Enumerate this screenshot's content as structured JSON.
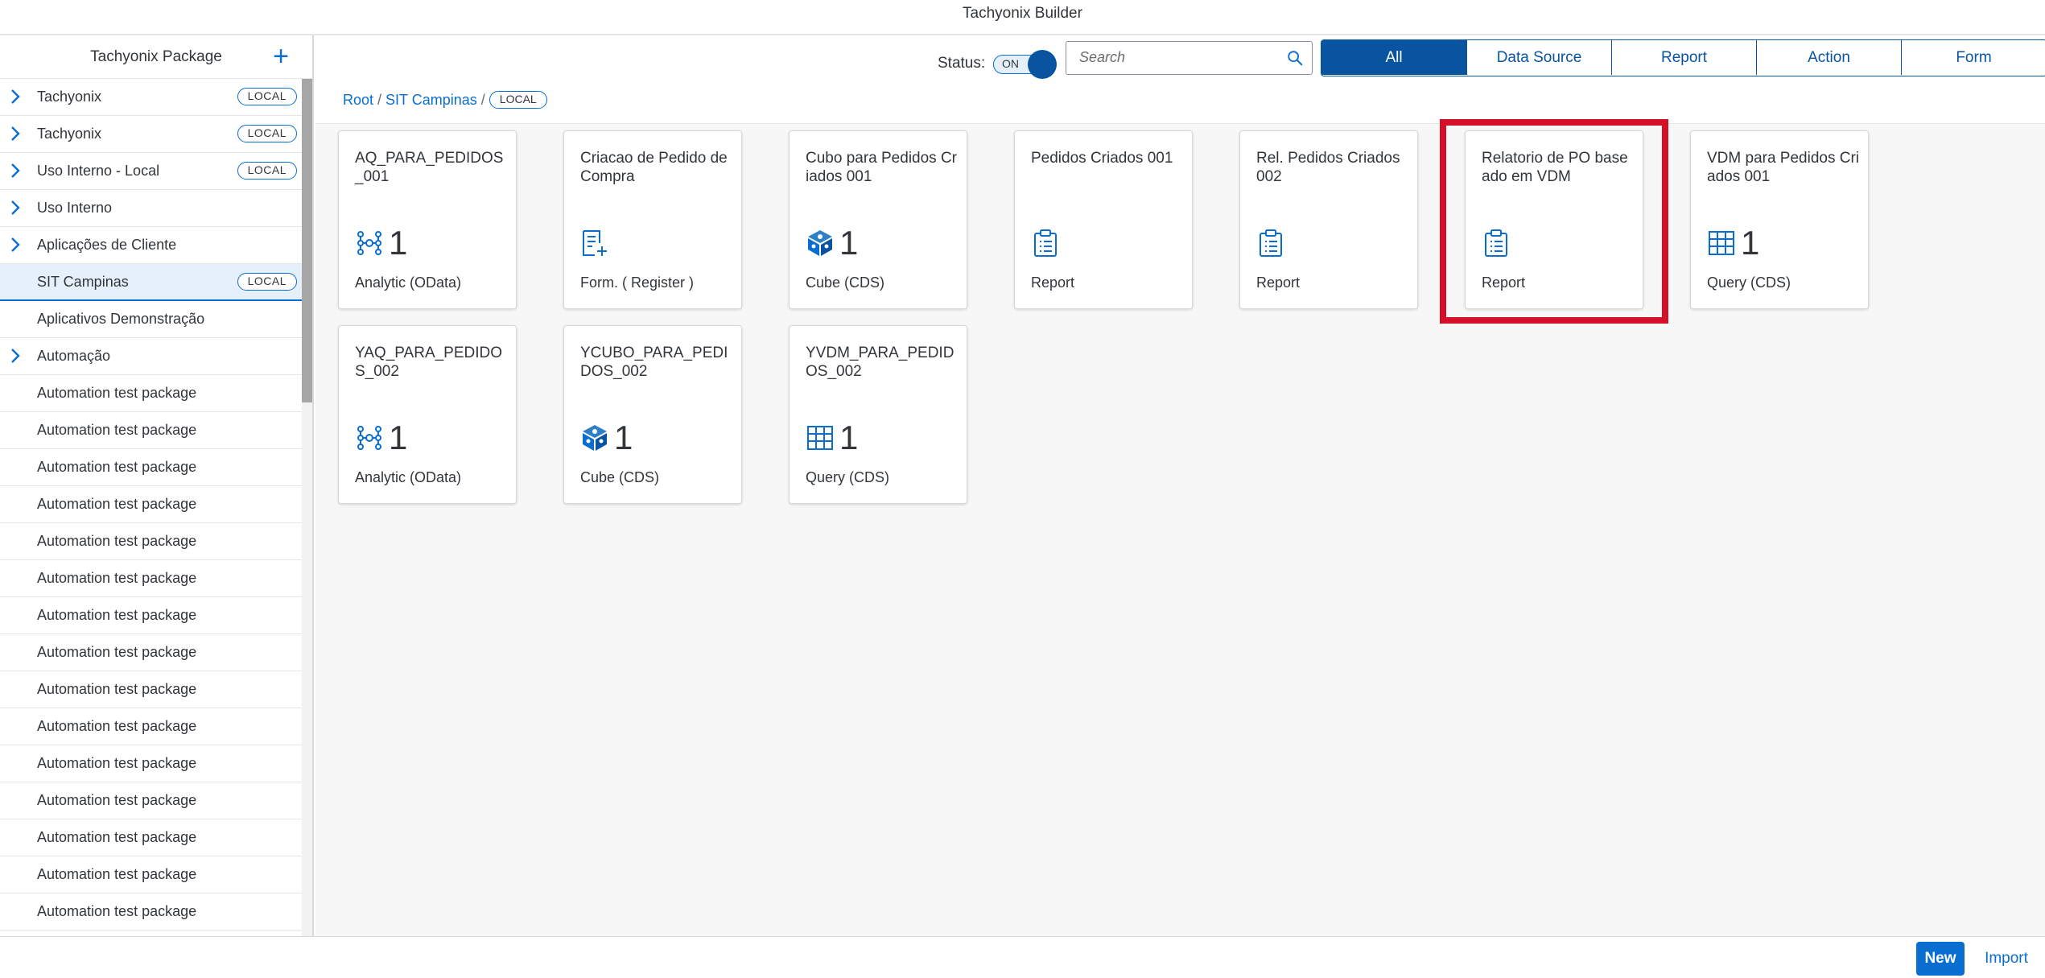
{
  "app": {
    "title": "Tachyonix Builder"
  },
  "sidebar": {
    "header": "Tachyonix Package",
    "add_icon": "plus-icon",
    "items": [
      {
        "label": "Tachyonix",
        "expandable": true,
        "badge": "LOCAL",
        "selected": false
      },
      {
        "label": "Tachyonix",
        "expandable": true,
        "badge": "LOCAL",
        "selected": false
      },
      {
        "label": "Uso Interno - Local",
        "expandable": true,
        "badge": "LOCAL",
        "selected": false
      },
      {
        "label": "Uso Interno",
        "expandable": true,
        "badge": "",
        "selected": false
      },
      {
        "label": "Aplicações de Cliente",
        "expandable": true,
        "badge": "",
        "selected": false
      },
      {
        "label": "SIT Campinas",
        "expandable": false,
        "badge": "LOCAL",
        "selected": true
      },
      {
        "label": "Aplicativos Demonstração",
        "expandable": false,
        "badge": "",
        "selected": false
      },
      {
        "label": "Automação",
        "expandable": true,
        "badge": "",
        "selected": false
      },
      {
        "label": "Automation test package",
        "expandable": false,
        "badge": "",
        "selected": false
      },
      {
        "label": "Automation test package",
        "expandable": false,
        "badge": "",
        "selected": false
      },
      {
        "label": "Automation test package",
        "expandable": false,
        "badge": "",
        "selected": false
      },
      {
        "label": "Automation test package",
        "expandable": false,
        "badge": "",
        "selected": false
      },
      {
        "label": "Automation test package",
        "expandable": false,
        "badge": "",
        "selected": false
      },
      {
        "label": "Automation test package",
        "expandable": false,
        "badge": "",
        "selected": false
      },
      {
        "label": "Automation test package",
        "expandable": false,
        "badge": "",
        "selected": false
      },
      {
        "label": "Automation test package",
        "expandable": false,
        "badge": "",
        "selected": false
      },
      {
        "label": "Automation test package",
        "expandable": false,
        "badge": "",
        "selected": false
      },
      {
        "label": "Automation test package",
        "expandable": false,
        "badge": "",
        "selected": false
      },
      {
        "label": "Automation test package",
        "expandable": false,
        "badge": "",
        "selected": false
      },
      {
        "label": "Automation test package",
        "expandable": false,
        "badge": "",
        "selected": false
      },
      {
        "label": "Automation test package",
        "expandable": false,
        "badge": "",
        "selected": false
      },
      {
        "label": "Automation test package",
        "expandable": false,
        "badge": "",
        "selected": false
      },
      {
        "label": "Automation test package",
        "expandable": false,
        "badge": "",
        "selected": false
      }
    ]
  },
  "toolbar": {
    "status_label": "Status:",
    "toggle_text": "ON",
    "search_placeholder": "Search",
    "filters": [
      {
        "label": "All",
        "active": true
      },
      {
        "label": "Data Source",
        "active": false
      },
      {
        "label": "Report",
        "active": false
      },
      {
        "label": "Action",
        "active": false
      },
      {
        "label": "Form",
        "active": false
      }
    ]
  },
  "breadcrumb": {
    "root": "Root",
    "package": "SIT Campinas",
    "badge": "LOCAL"
  },
  "cards": [
    {
      "title": "AQ_PARA_PEDIDOS_001",
      "icon": "analytic-network-icon",
      "count": "1",
      "subtitle": "Analytic (OData)",
      "highlighted": false
    },
    {
      "title": "Criacao de Pedido de Compra",
      "icon": "form-add-icon",
      "count": "",
      "subtitle": "Form. ( Register )",
      "highlighted": false
    },
    {
      "title": "Cubo para Pedidos Criados 001",
      "icon": "cube-icon",
      "count": "1",
      "subtitle": "Cube (CDS)",
      "highlighted": false
    },
    {
      "title": "Pedidos Criados 001",
      "icon": "clipboard-report-icon",
      "count": "",
      "subtitle": "Report",
      "highlighted": false
    },
    {
      "title": "Rel. Pedidos Criados 002",
      "icon": "clipboard-report-icon",
      "count": "",
      "subtitle": "Report",
      "highlighted": false
    },
    {
      "title": "Relatorio de PO baseado em VDM",
      "icon": "clipboard-report-icon",
      "count": "",
      "subtitle": "Report",
      "highlighted": true
    },
    {
      "title": "VDM para Pedidos Criados 001",
      "icon": "table-grid-icon",
      "count": "1",
      "subtitle": "Query (CDS)",
      "highlighted": false
    },
    {
      "title": "YAQ_PARA_PEDIDOS_002",
      "icon": "analytic-network-icon",
      "count": "1",
      "subtitle": "Analytic (OData)",
      "highlighted": false
    },
    {
      "title": "YCUBO_PARA_PEDIDOS_002",
      "icon": "cube-icon",
      "count": "1",
      "subtitle": "Cube (CDS)",
      "highlighted": false
    },
    {
      "title": "YVDM_PARA_PEDIDOS_002",
      "icon": "table-grid-icon",
      "count": "1",
      "subtitle": "Query (CDS)",
      "highlighted": false
    }
  ],
  "footer": {
    "new_label": "New",
    "import_label": "Import"
  },
  "colors": {
    "accent": "#0a6ed1",
    "accent_dark": "#0854a0",
    "highlight": "#d60f28"
  }
}
